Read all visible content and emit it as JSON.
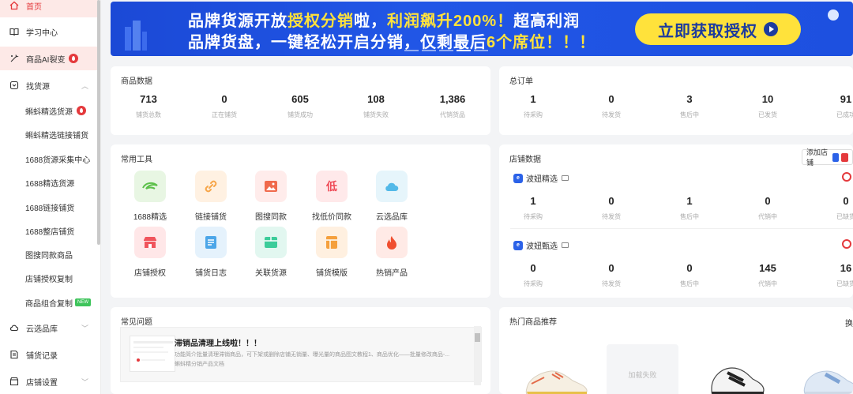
{
  "sidebar": {
    "items": [
      {
        "label": "首页"
      },
      {
        "label": "学习中心"
      },
      {
        "label": "商品AI裂变"
      },
      {
        "label": "找货源"
      },
      {
        "label": "云选品库"
      },
      {
        "label": "铺货记录"
      },
      {
        "label": "店铺设置"
      }
    ],
    "sub_items": [
      {
        "label": "蝌蚪精选货源"
      },
      {
        "label": "蝌蚪精选链接铺货"
      },
      {
        "label": "1688货源采集中心"
      },
      {
        "label": "1688精选货源"
      },
      {
        "label": "1688链接铺货"
      },
      {
        "label": "1688整店铺货"
      },
      {
        "label": "图搜同款商品"
      },
      {
        "label": "店铺授权复制"
      },
      {
        "label": "商品组合复制"
      }
    ],
    "new_badge": "NEW"
  },
  "banner": {
    "line1_a": "品牌货源开放",
    "line1_b": "授权分销",
    "line1_c": "啦，",
    "line1_d": "利润飙升200%！",
    "line1_e": "超高利润",
    "line2_a": "品牌货盘，一键轻松开启分销，仅剩最后",
    "line2_b": "6个席位！！！",
    "cta": "立即获取授权"
  },
  "product_data": {
    "title": "商品数据",
    "stats": [
      {
        "value": "713",
        "label": "铺货总数"
      },
      {
        "value": "0",
        "label": "正在铺货"
      },
      {
        "value": "605",
        "label": "铺货成功"
      },
      {
        "value": "108",
        "label": "铺货失败"
      },
      {
        "value": "1,386",
        "label": "代销货品"
      }
    ]
  },
  "orders": {
    "title": "总订单",
    "stats": [
      {
        "value": "1",
        "label": "待采购"
      },
      {
        "value": "0",
        "label": "待发货"
      },
      {
        "value": "3",
        "label": "售后中"
      },
      {
        "value": "10",
        "label": "已发货"
      },
      {
        "value": "91",
        "label": "已成功"
      }
    ]
  },
  "tools": {
    "title": "常用工具",
    "items": [
      {
        "label": "1688精选",
        "icon": "alibaba-icon",
        "bg": "#e8f6e3",
        "fg": "#5cc04a"
      },
      {
        "label": "链接铺货",
        "icon": "link-icon",
        "bg": "#fff1e2",
        "fg": "#f7a64a"
      },
      {
        "label": "图搜同款",
        "icon": "image-icon",
        "bg": "#ffeceb",
        "fg": "#f06a4c"
      },
      {
        "label": "找低价同款",
        "icon": "low-price-icon",
        "bg": "#ffe9ea",
        "fg": "#ef4b57"
      },
      {
        "label": "云选品库",
        "icon": "cloud-icon",
        "bg": "#e6f5fb",
        "fg": "#52b9e8"
      },
      {
        "label": "店铺授权",
        "icon": "store-icon",
        "bg": "#ffe7e8",
        "fg": "#f0545c"
      },
      {
        "label": "铺货日志",
        "icon": "log-icon",
        "bg": "#e5f2fc",
        "fg": "#4ca6e8"
      },
      {
        "label": "关联货源",
        "icon": "box-icon",
        "bg": "#e2f7f0",
        "fg": "#3ccc9a"
      },
      {
        "label": "铺货模版",
        "icon": "template-icon",
        "bg": "#fff0e0",
        "fg": "#f5a03d"
      },
      {
        "label": "热销产品",
        "icon": "fire-icon",
        "bg": "#ffeae6",
        "fg": "#f04e2f"
      }
    ]
  },
  "shop_data": {
    "title": "店铺数据",
    "add_shop": "添加店铺",
    "shops": [
      {
        "name": "波妞精选",
        "stats": [
          {
            "value": "1",
            "label": "待采购"
          },
          {
            "value": "0",
            "label": "待发货"
          },
          {
            "value": "1",
            "label": "售后中"
          },
          {
            "value": "0",
            "label": "代销中"
          },
          {
            "value": "0",
            "label": "已缺货"
          }
        ]
      },
      {
        "name": "波妞甄选",
        "stats": [
          {
            "value": "0",
            "label": "待采购"
          },
          {
            "value": "0",
            "label": "待发货"
          },
          {
            "value": "0",
            "label": "售后中"
          },
          {
            "value": "145",
            "label": "代销中"
          },
          {
            "value": "16",
            "label": "已缺货"
          }
        ]
      }
    ]
  },
  "faq": {
    "title": "常见问题",
    "item_title": "滞销品清理上线啦！！！",
    "item_desc": "功能简介批量清理滞销商品，可下架或删除店铺无销量、曝光量的商品图文教程1、商品优化——批量修改商品-...",
    "item_source": "蝌蚪精分销产品文档"
  },
  "hot": {
    "title": "热门商品推荐",
    "more": "换",
    "fail_text": "加载失败"
  }
}
